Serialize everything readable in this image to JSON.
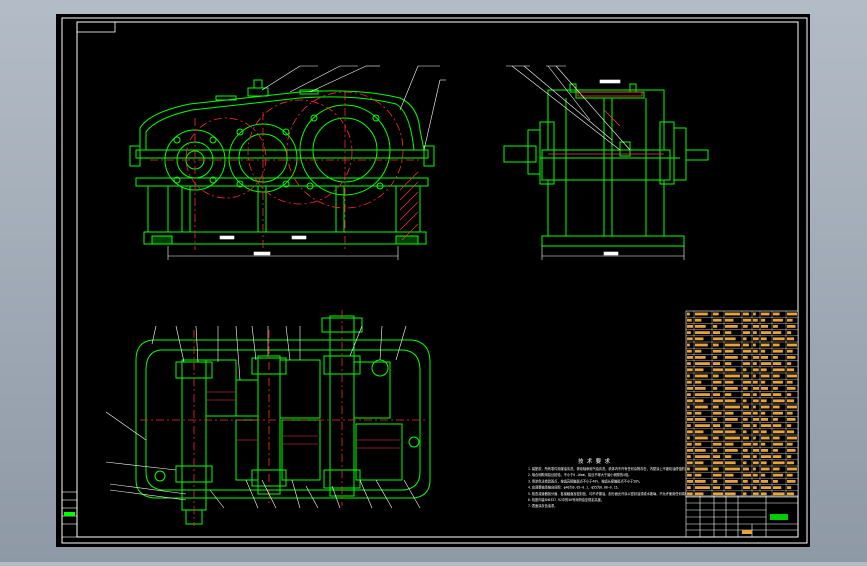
{
  "notes": {
    "title": "技 术 要 求",
    "lines": [
      "1.装配前，所有零件用煤油清洗，滚动轴承用汽油清洗，机体内不许有任何杂物存在，内壁涂上不被机油侵蚀的涂料两次。",
      "2.啮合侧隙用铅丝检验，不小于0.16mm，铅丝不得大于最小侧隙的4倍。",
      "3.用涂色法检验斑点，按齿高接触斑点不小于40%，按齿长接触斑点不小于50%。",
      "4.应调整轴承轴向间隙：φ40为0.05~0.1，φ55为0.08~0.15。",
      "5.检查减速器剖分面、各接触面及密封处，均不许漏油，剖分面允许涂以密封油漆或水玻璃，不允许使用任何填料。",
      "6.机座内装SH0357-92中的50号润滑油至规定高度。",
      "7.表面涂灰色油漆。"
    ]
  },
  "colors": {
    "background": "#000000",
    "frame": "#ffffff",
    "outline": "#00ff00",
    "centerline": "#ff2a2a",
    "dimension": "#ffffff",
    "table_fill": "#e8a23a",
    "table_text": "#ffffff"
  }
}
